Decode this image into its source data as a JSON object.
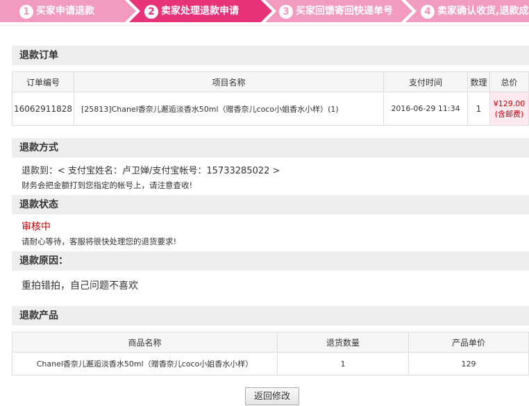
{
  "steps": [
    {
      "num": "1",
      "label": "买家申请退款",
      "active": false
    },
    {
      "num": "2",
      "label": "卖家处理退款申请",
      "active": true
    },
    {
      "num": "3",
      "label": "买家回馈寄回快递单号",
      "active": false
    },
    {
      "num": "4",
      "label": "卖家确认收货,退款成",
      "active": false
    }
  ],
  "colors": {
    "active_step": "#e8337a",
    "inactive_step": "#f29ac0",
    "alert_red": "#cc0000"
  },
  "order": {
    "title": "退款订单",
    "headers": [
      "订单编号",
      "项目名称",
      "支付时间",
      "数理",
      "总价"
    ],
    "row": {
      "order_no": "16062911828",
      "item": "[25813]Chanel香奈儿邂逅淡香水50ml（赠香奈儿coco小姐香水小样）(1)",
      "pay_time": "2016-06-29 11:34",
      "qty": "1",
      "price": "¥129.00",
      "price_note": "(含邮费)"
    }
  },
  "method": {
    "title": "退款方式",
    "line1": "退款到：< 支付宝姓名：卢卫婵/支付宝帐号：15733285022 >",
    "line2": "财务会把金额打到您指定的帐号上，请注意查收!"
  },
  "status": {
    "title": "退款状态",
    "value": "审核中",
    "note": "请耐心等待，客服将很快处理您的退货要求!"
  },
  "reason": {
    "title": "退款原因：",
    "value": "重拍错拍，自己问题不喜欢"
  },
  "product": {
    "title": "退款产品",
    "headers": [
      "商品名称",
      "退货数量",
      "产品单价"
    ],
    "row": {
      "name": "Chanel香奈儿邂逅淡香水50ml（赠香奈儿coco小姐香水小样）",
      "qty": "1",
      "price": "129"
    }
  },
  "button": {
    "label": "返回修改"
  }
}
